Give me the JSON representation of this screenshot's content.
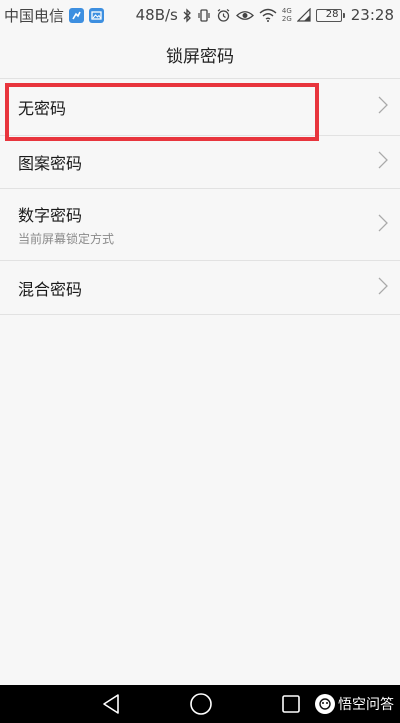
{
  "status_bar": {
    "carrier": "中国电信",
    "net_speed": "48B/s",
    "net_type_top": "4G",
    "net_type_bottom": "2G",
    "battery": "28",
    "time": "23:28"
  },
  "header": {
    "title": "锁屏密码"
  },
  "options": [
    {
      "label": "无密码",
      "sublabel": ""
    },
    {
      "label": "图案密码",
      "sublabel": ""
    },
    {
      "label": "数字密码",
      "sublabel": "当前屏幕锁定方式"
    },
    {
      "label": "混合密码",
      "sublabel": ""
    }
  ],
  "watermark": {
    "text": "悟空问答"
  },
  "colors": {
    "highlight": "#e8353d",
    "background": "#f7f7f7",
    "nav_bar": "#000000"
  }
}
